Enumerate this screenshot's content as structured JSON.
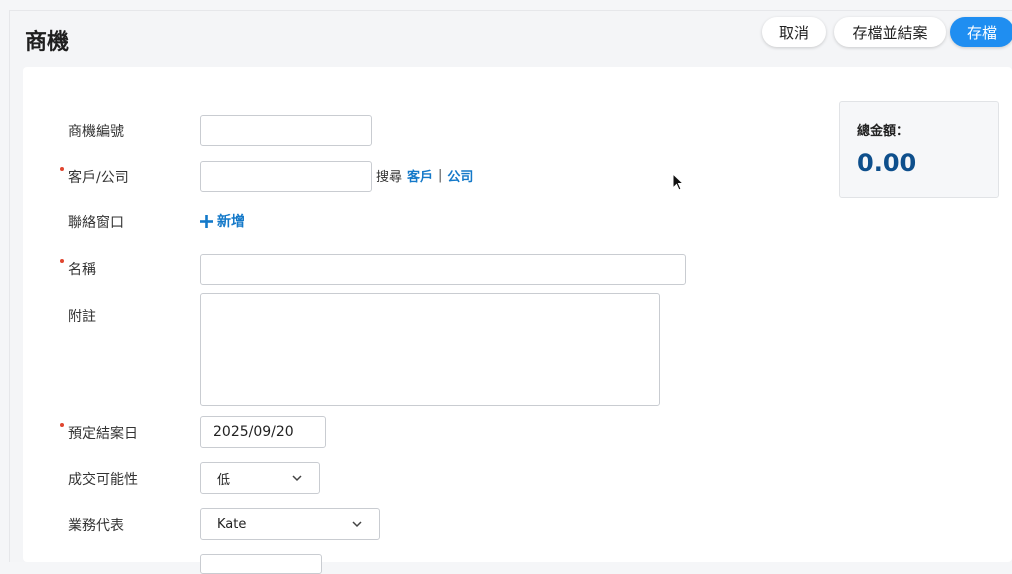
{
  "header": {
    "title": "商機",
    "cancel_label": "取消",
    "save_close_label": "存檔並結案",
    "save_label": "存檔"
  },
  "form": {
    "opportunity_no": {
      "label": "商機編號",
      "value": ""
    },
    "customer": {
      "label": "客戶/公司",
      "required": true,
      "value": "",
      "search_prefix": "搜尋",
      "search_customer": "客戶",
      "separator": "|",
      "search_company": "公司"
    },
    "contact": {
      "label": "聯絡窗口",
      "add_label": "新增",
      "add_icon": "plus-icon"
    },
    "name": {
      "label": "名稱",
      "required": true,
      "value": ""
    },
    "note": {
      "label": "附註",
      "value": ""
    },
    "close_date": {
      "label": "預定結案日",
      "required": true,
      "value": "2025/09/20"
    },
    "probability": {
      "label": "成交可能性",
      "value": "低"
    },
    "sales_rep": {
      "label": "業務代表",
      "value": "Kate"
    }
  },
  "summary": {
    "total_label": "總金額：",
    "total_value": "0.00"
  },
  "colors": {
    "accent": "#1f8ef1",
    "link": "#1479c9",
    "required": "#e0462f",
    "total": "#0e4f8c"
  }
}
